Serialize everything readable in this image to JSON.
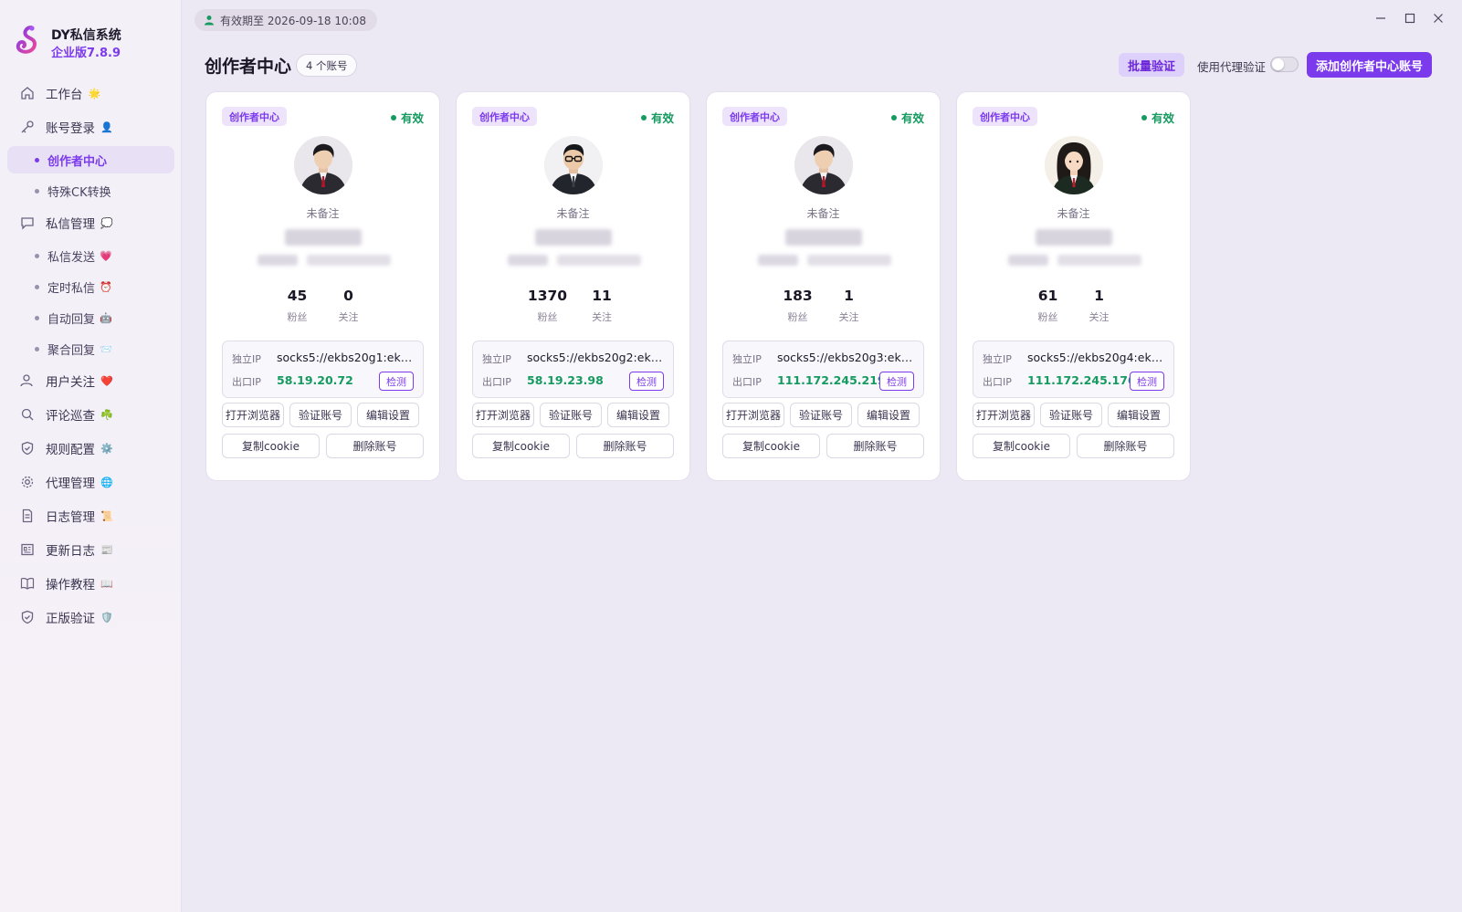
{
  "brand": {
    "name": "DY私信系统",
    "version": "企业版7.8.9"
  },
  "sidebar": {
    "workbench": {
      "label": "工作台",
      "emoji": "🌟"
    },
    "login": {
      "label": "账号登录",
      "emoji": "👤"
    },
    "creator_center": {
      "label": "创作者中心"
    },
    "ck_convert": {
      "label": "特殊CK转换"
    },
    "dm_manage": {
      "label": "私信管理",
      "emoji": "💭"
    },
    "dm_send": {
      "label": "私信发送",
      "emoji": "💗"
    },
    "dm_timed": {
      "label": "定时私信",
      "emoji": "⏰"
    },
    "auto_reply": {
      "label": "自动回复",
      "emoji": "🤖"
    },
    "aggregate_reply": {
      "label": "聚合回复",
      "emoji": "📨"
    },
    "user_follow": {
      "label": "用户关注",
      "emoji": "❤️"
    },
    "comment_patrol": {
      "label": "评论巡查",
      "emoji": "☘️"
    },
    "rules": {
      "label": "规则配置",
      "emoji": "⚙️"
    },
    "proxy": {
      "label": "代理管理",
      "emoji": "🌐"
    },
    "logs": {
      "label": "日志管理",
      "emoji": "📜"
    },
    "changelog": {
      "label": "更新日志",
      "emoji": "📰"
    },
    "tutorial": {
      "label": "操作教程",
      "emoji": "📖"
    },
    "license": {
      "label": "正版验证",
      "emoji": "🛡️"
    }
  },
  "topbar": {
    "expiry": "有效期至 2026-09-18 10:08"
  },
  "header": {
    "title": "创作者中心",
    "count": "4 个账号",
    "batch_verify": "批量验证",
    "proxy_verify_label": "使用代理验证",
    "proxy_verify_on": false,
    "add_account": "添加创作者中心账号"
  },
  "labels": {
    "tag": "创作者中心",
    "status": "有效",
    "remark": "未备注",
    "fans": "粉丝",
    "follow": "关注",
    "ip_label": "独立IP",
    "out_ip_label": "出口IP",
    "detect": "检测",
    "open_browser": "打开浏览器",
    "verify_account": "验证账号",
    "edit_settings": "编辑设置",
    "copy_cookie": "复制cookie",
    "delete_account": "删除账号"
  },
  "accounts": [
    {
      "fans": "45",
      "follow": "0",
      "proxy": "socks5://ekbs20g1:ekbs...",
      "out_ip": "58.19.20.72",
      "avatar": "male-suit-black-robe"
    },
    {
      "fans": "1370",
      "follow": "11",
      "proxy": "socks5://ekbs20g2:ekbs...",
      "out_ip": "58.19.23.98",
      "avatar": "male-glasses-suit"
    },
    {
      "fans": "183",
      "follow": "1",
      "proxy": "socks5://ekbs20g3:ekbs...",
      "out_ip": "111.172.245.219",
      "avatar": "male-suit-black-robe"
    },
    {
      "fans": "61",
      "follow": "1",
      "proxy": "socks5://ekbs20g4:ekbs...",
      "out_ip": "111.172.245.176",
      "avatar": "female-robe"
    }
  ],
  "colors": {
    "accent": "#7c3aed",
    "success": "#159a5f",
    "background": "#ede9f4"
  }
}
